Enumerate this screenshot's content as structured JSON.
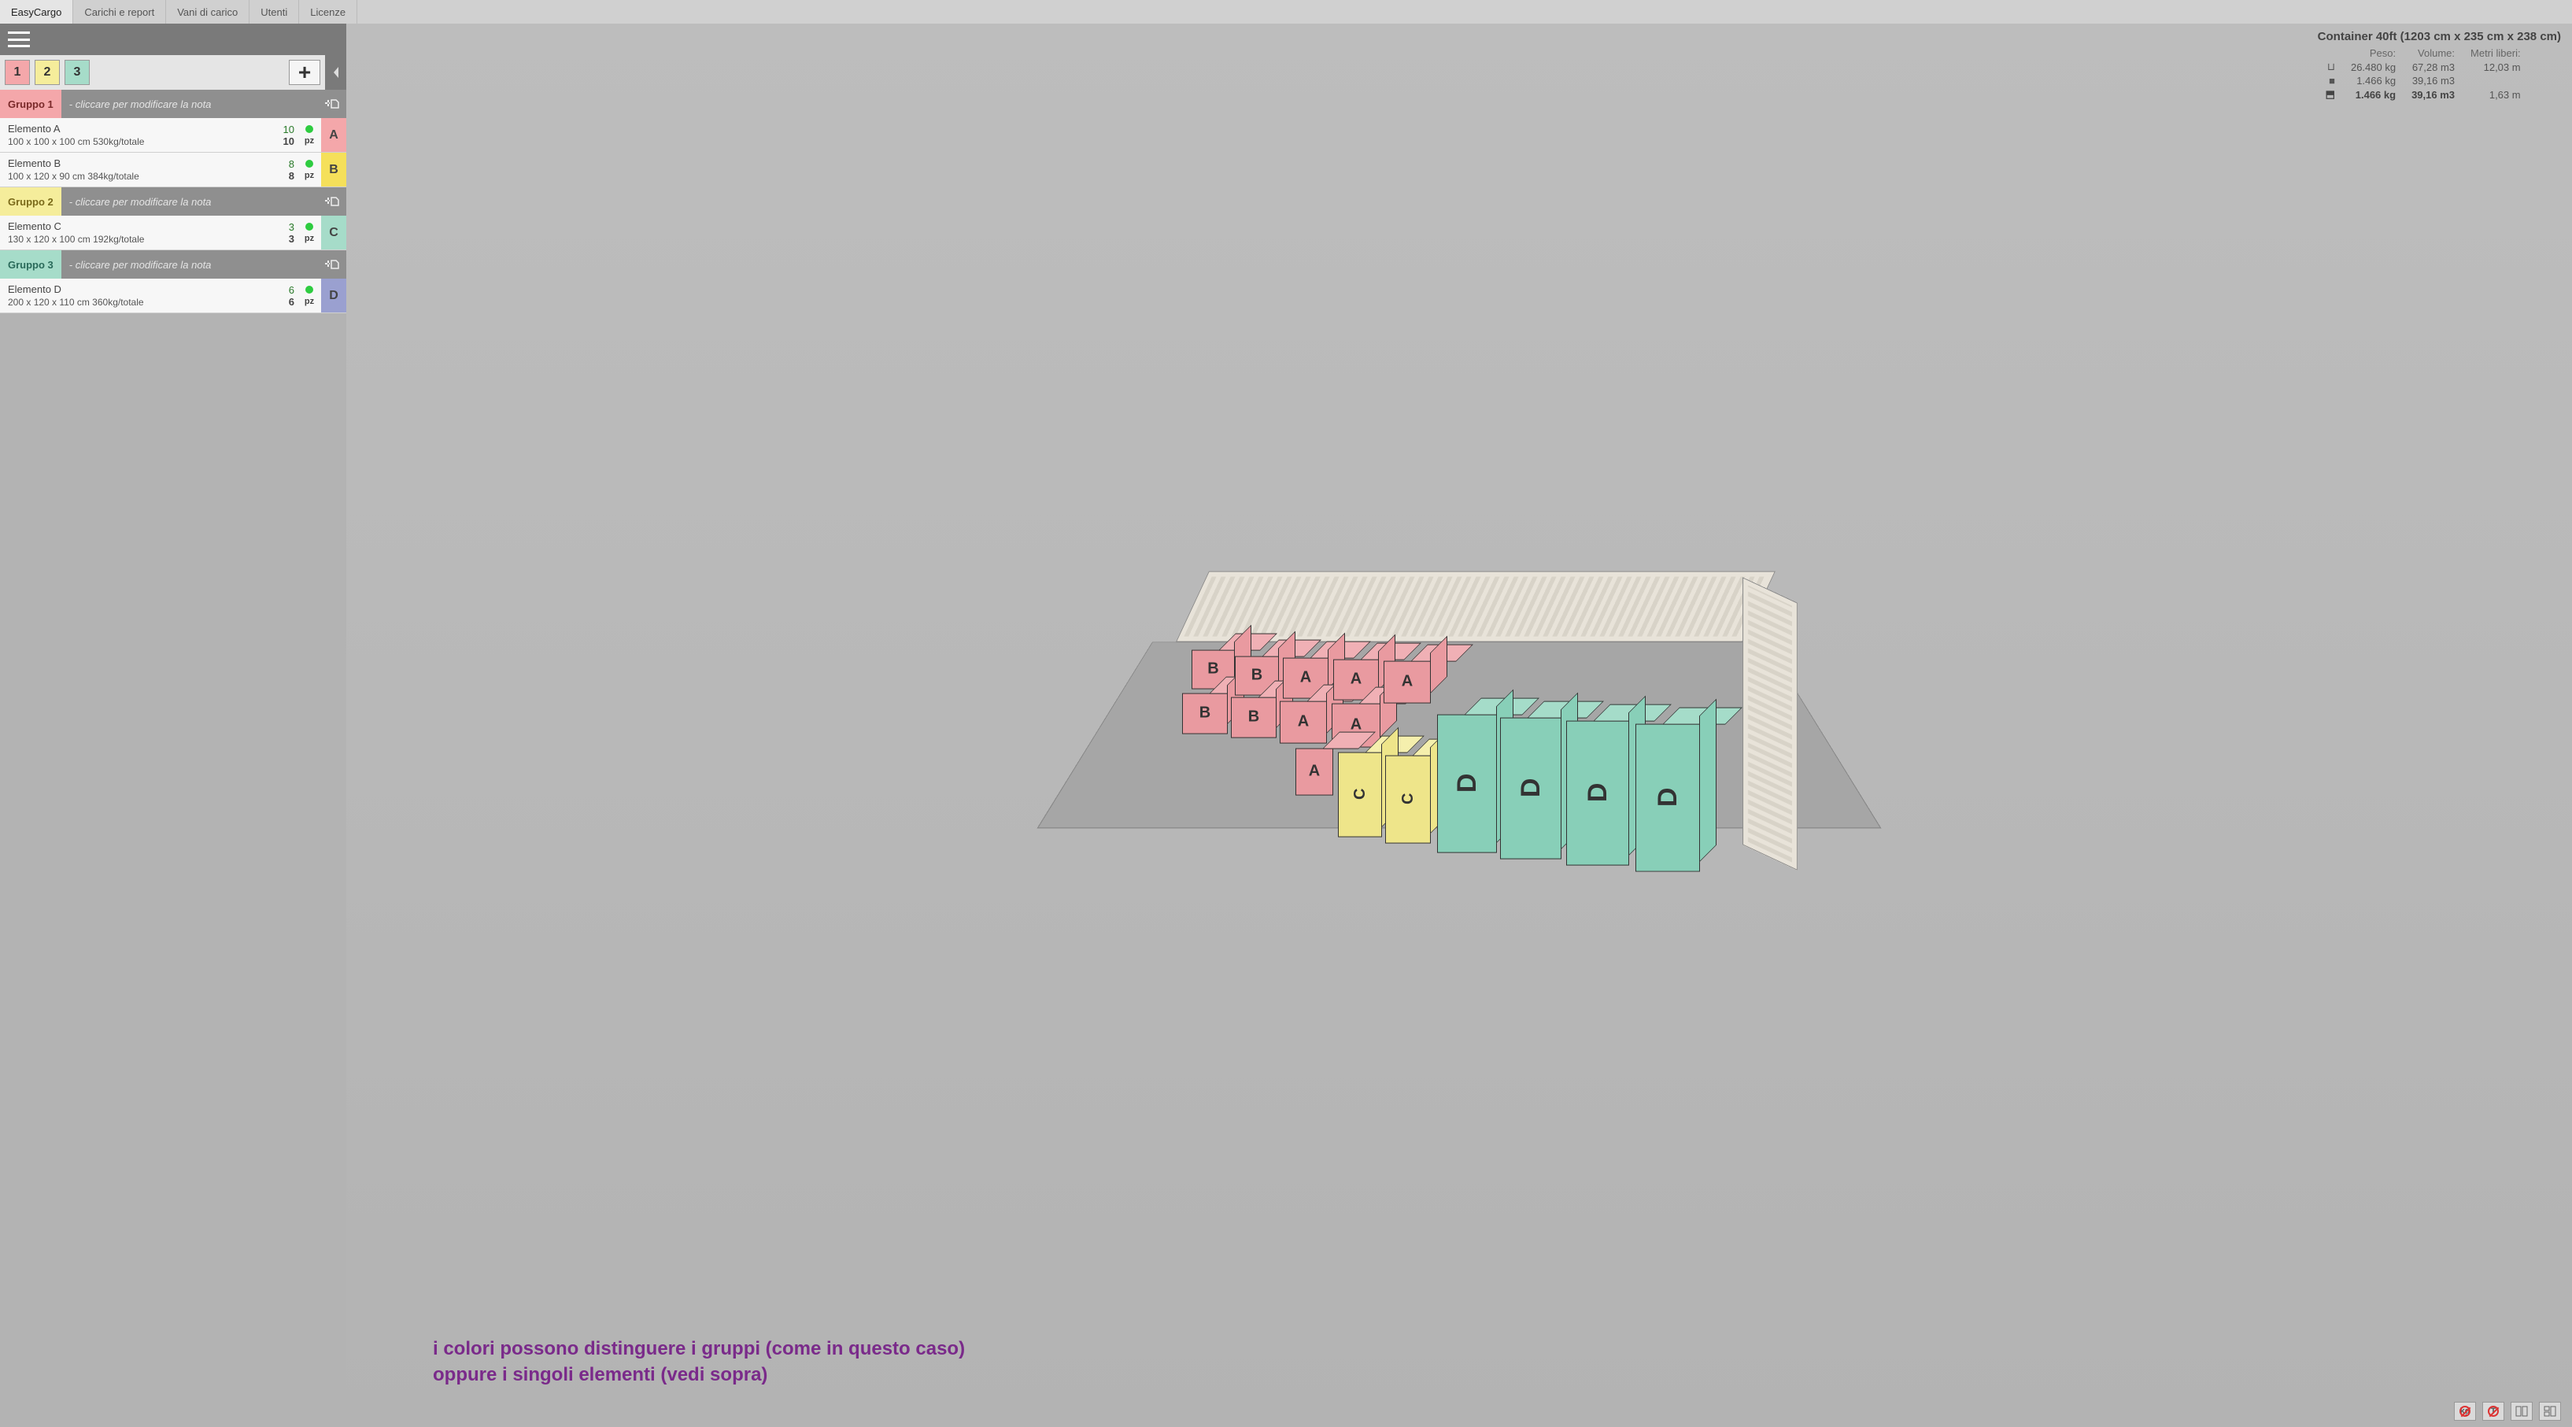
{
  "nav": {
    "items": [
      {
        "label": "EasyCargo",
        "active": true
      },
      {
        "label": "Carichi e report"
      },
      {
        "label": "Vani di carico"
      },
      {
        "label": "Utenti"
      },
      {
        "label": "Licenze"
      }
    ]
  },
  "selectors": [
    {
      "label": "1",
      "cls": "c1"
    },
    {
      "label": "2",
      "cls": "c2"
    },
    {
      "label": "3",
      "cls": "c3"
    }
  ],
  "plus_label": "+",
  "groups": [
    {
      "id": "g1",
      "label": "Gruppo 1",
      "cls": "gh1",
      "note": "- cliccare per modificare la nota",
      "items": [
        {
          "name": "Elemento A",
          "dim": "100 x 100 x 100 cm 530kg/totale",
          "n1": "10",
          "n2": "10",
          "unit": "pz",
          "letter": "A",
          "lcls": "lA"
        },
        {
          "name": "Elemento B",
          "dim": "100 x 120 x 90 cm 384kg/totale",
          "n1": "8",
          "n2": "8",
          "unit": "pz",
          "letter": "B",
          "lcls": "lB"
        }
      ]
    },
    {
      "id": "g2",
      "label": "Gruppo 2",
      "cls": "gh2",
      "note": "- cliccare per modificare la nota",
      "items": [
        {
          "name": "Elemento C",
          "dim": "130 x 120 x 100 cm 192kg/totale",
          "n1": "3",
          "n2": "3",
          "unit": "pz",
          "letter": "C",
          "lcls": "lC"
        }
      ]
    },
    {
      "id": "g3",
      "label": "Gruppo 3",
      "cls": "gh3",
      "note": "- cliccare per modificare la nota",
      "items": [
        {
          "name": "Elemento D",
          "dim": "200 x 120 x 110 cm 360kg/totale",
          "n1": "6",
          "n2": "6",
          "unit": "pz",
          "letter": "D",
          "lcls": "lD"
        }
      ]
    }
  ],
  "stats": {
    "title": "Container 40ft (1203 cm x 235 cm x 238 cm)",
    "headers": {
      "peso": "Peso:",
      "volume": "Volume:",
      "metri": "Metri liberi:"
    },
    "rows": [
      {
        "icon": "⊔",
        "peso": "26.480 kg",
        "vol": "67,28 m3",
        "metri": "12,03 m",
        "bold": false
      },
      {
        "icon": "■",
        "peso": "1.466 kg",
        "vol": "39,16 m3",
        "metri": "",
        "bold": false
      },
      {
        "icon": "⬒",
        "peso": "1.466 kg",
        "vol": "39,16 m3",
        "metri": "1,63 m",
        "bold": true
      }
    ]
  },
  "annotation": {
    "line1": "i colori possono distinguere i gruppi (come in questo caso)",
    "line2": "oppure i singoli elementi (vedi sopra)"
  },
  "toolbar": {
    "kg": "kg",
    "t": "T"
  }
}
